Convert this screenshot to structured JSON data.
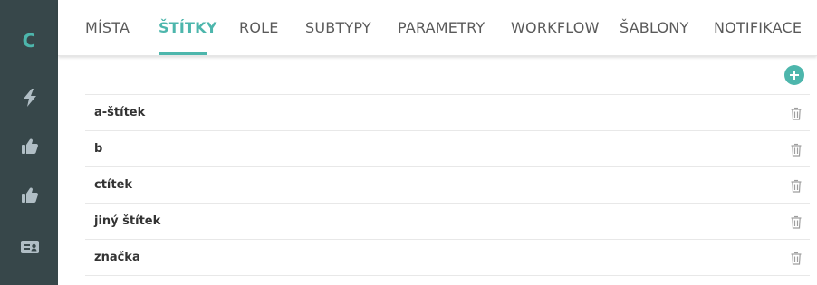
{
  "colors": {
    "accent": "#4db6ac",
    "sidebar_bg": "#37474a",
    "sidebar_icon": "#b0bec5",
    "tab_text": "#5a5a5a",
    "row_text": "#333333",
    "trash_icon": "#9e9e9e"
  },
  "sidebar": {
    "logo": "C",
    "items": [
      {
        "icon": "lightning-icon"
      },
      {
        "icon": "thumbs-up-icon"
      },
      {
        "icon": "thumbs-up-icon"
      },
      {
        "icon": "id-card-icon"
      }
    ]
  },
  "tabs": [
    {
      "label": "MÍSTA",
      "active": false
    },
    {
      "label": "ŠTÍTKY",
      "active": true
    },
    {
      "label": "ROLE",
      "active": false
    },
    {
      "label": "SUBTYPY",
      "active": false
    },
    {
      "label": "PARAMETRY",
      "active": false
    },
    {
      "label": "WORKFLOW",
      "active": false
    },
    {
      "label": "ŠABLONY",
      "active": false
    },
    {
      "label": "NOTIFIKACE",
      "active": false
    }
  ],
  "actions": {
    "add_icon": "plus-circle-icon"
  },
  "labels": [
    {
      "name": "a-štítek",
      "delete_icon": "trash-icon"
    },
    {
      "name": "b",
      "delete_icon": "trash-icon"
    },
    {
      "name": "ctítek",
      "delete_icon": "trash-icon"
    },
    {
      "name": "jiný štítek",
      "delete_icon": "trash-icon"
    },
    {
      "name": "značka",
      "delete_icon": "trash-icon"
    }
  ]
}
